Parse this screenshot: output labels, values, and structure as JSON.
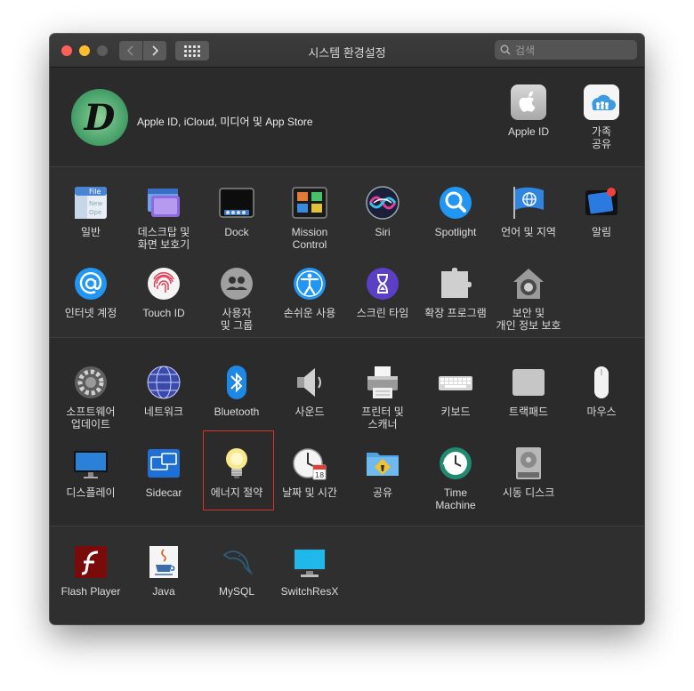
{
  "window": {
    "title": "시스템 환경설정"
  },
  "search": {
    "placeholder": "검색"
  },
  "apple_account": {
    "profile_label": "Apple ID, iCloud, 미디어 및 App Store",
    "apple_id_label": "Apple ID",
    "family_label": "가족\n공유"
  },
  "row1": [
    {
      "name": "general",
      "label": "일반",
      "icon": "file-window-icon",
      "color": "#5b8fd6"
    },
    {
      "name": "desktop",
      "label": "데스크탑 및\n화면 보호기",
      "icon": "desktop-screensaver-icon",
      "color": "#7b5bd6"
    },
    {
      "name": "dock",
      "label": "Dock",
      "icon": "dock-icon",
      "color": "#1c1c1c"
    },
    {
      "name": "mission-control",
      "label": "Mission\nControl",
      "icon": "mission-control-icon",
      "color": "#222"
    },
    {
      "name": "siri",
      "label": "Siri",
      "icon": "siri-icon",
      "color": "#1a1a2e"
    },
    {
      "name": "spotlight",
      "label": "Spotlight",
      "icon": "spotlight-icon",
      "color": "#1e88e5"
    },
    {
      "name": "language",
      "label": "언어 및 지역",
      "icon": "flag-globe-icon",
      "color": "#2f7fe0"
    },
    {
      "name": "notifications",
      "label": "알림",
      "icon": "notifications-icon",
      "color": "#2a6fd6"
    }
  ],
  "row2": [
    {
      "name": "internet-accounts",
      "label": "인터넷 계정",
      "icon": "at-sign-icon",
      "color": "#1e88e5"
    },
    {
      "name": "touch-id",
      "label": "Touch ID",
      "icon": "fingerprint-icon",
      "color": "#f2f2f2"
    },
    {
      "name": "users-groups",
      "label": "사용자\n및 그룹",
      "icon": "users-icon",
      "color": "#9e9e9e"
    },
    {
      "name": "accessibility",
      "label": "손쉬운 사용",
      "icon": "accessibility-icon",
      "color": "#1e88e5"
    },
    {
      "name": "screen-time",
      "label": "스크린 타임",
      "icon": "hourglass-icon",
      "color": "#5e3fc2"
    },
    {
      "name": "extensions",
      "label": "확장 프로그램",
      "icon": "puzzle-icon",
      "color": "#c8c8c8"
    },
    {
      "name": "security",
      "label": "보안 및\n개인 정보 보호",
      "icon": "house-lock-icon",
      "color": "#8a8a8a"
    }
  ],
  "row3": [
    {
      "name": "software-update",
      "label": "소프트웨어\n업데이트",
      "icon": "gear-icon",
      "color": "#6b6b6b"
    },
    {
      "name": "network",
      "label": "네트워크",
      "icon": "globe-icon",
      "color": "#3f4fa8"
    },
    {
      "name": "bluetooth",
      "label": "Bluetooth",
      "icon": "bluetooth-icon",
      "color": "#1e88e5"
    },
    {
      "name": "sound",
      "label": "사운드",
      "icon": "speaker-icon",
      "color": "#9a9a9a"
    },
    {
      "name": "printers",
      "label": "프린터 및\n스캐너",
      "icon": "printer-icon",
      "color": "#bdbdbd"
    },
    {
      "name": "keyboard",
      "label": "키보드",
      "icon": "keyboard-icon",
      "color": "#d0d0d0"
    },
    {
      "name": "trackpad",
      "label": "트랙패드",
      "icon": "trackpad-icon",
      "color": "#c4c4c4"
    },
    {
      "name": "mouse",
      "label": "마우스",
      "icon": "mouse-icon",
      "color": "#efefef"
    }
  ],
  "row4": [
    {
      "name": "displays",
      "label": "디스플레이",
      "icon": "display-icon",
      "color": "#2a7fd6"
    },
    {
      "name": "sidecar",
      "label": "Sidecar",
      "icon": "sidecar-icon",
      "color": "#1e6fd6"
    },
    {
      "name": "energy-saver",
      "label": "에너지 절약",
      "icon": "lightbulb-icon",
      "color": "#f6e48a"
    },
    {
      "name": "date-time",
      "label": "날짜 및 시간",
      "icon": "clock-calendar-icon",
      "color": "#f0f0f0"
    },
    {
      "name": "sharing",
      "label": "공유",
      "icon": "sharing-folder-icon",
      "color": "#4fa3e0"
    },
    {
      "name": "time-machine",
      "label": "Time\nMachine",
      "icon": "time-machine-icon",
      "color": "#1f8f73"
    },
    {
      "name": "startup-disk",
      "label": "시동 디스크",
      "icon": "hard-drive-icon",
      "color": "#a8a8a8"
    }
  ],
  "row5": [
    {
      "name": "flash-player",
      "label": "Flash Player",
      "icon": "flash-icon",
      "color": "#8b0d0d"
    },
    {
      "name": "java",
      "label": "Java",
      "icon": "java-cup-icon",
      "color": "#f5f5f5"
    },
    {
      "name": "mysql",
      "label": "MySQL",
      "icon": "dolphin-icon",
      "color": "#2f5b7a"
    },
    {
      "name": "switchresx",
      "label": "SwitchResX",
      "icon": "monitor-icon",
      "color": "#1fb5e8"
    }
  ]
}
